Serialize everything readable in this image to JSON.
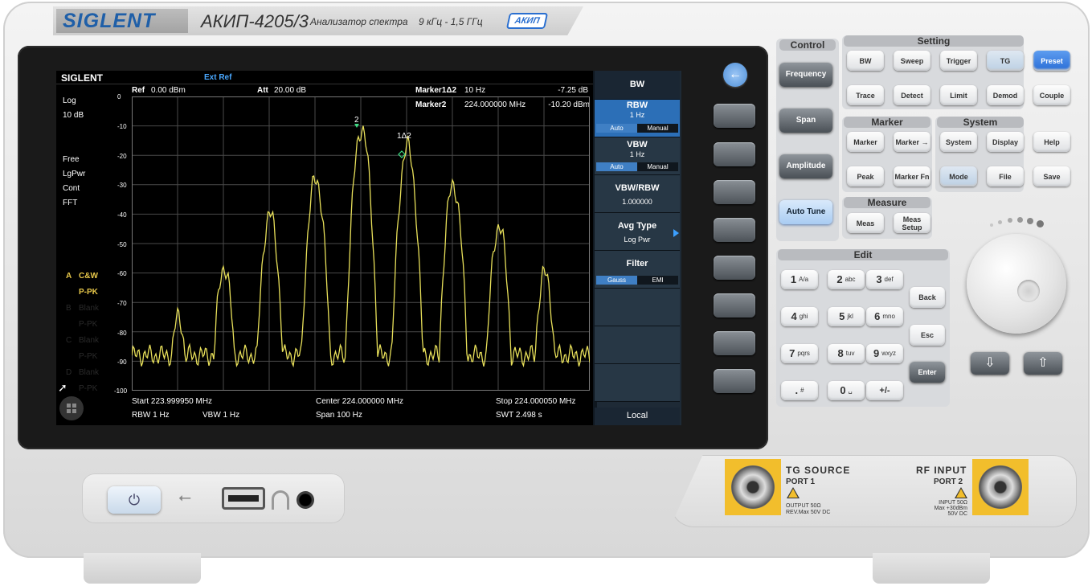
{
  "header": {
    "brand": "SIGLENT",
    "model": "АКИП-4205/3",
    "description": "Анализатор спектра",
    "freq_range": "9 кГц - 1,5 ГГц",
    "akip_logo": "АКИП"
  },
  "screen": {
    "logo": "SIGLENT",
    "ext_ref": "Ext Ref",
    "ref_label": "Ref",
    "ref_value": "0.00 dBm",
    "att_label": "Att",
    "att_value": "20.00 dB",
    "marker1_label": "Marker1Δ2",
    "marker1_freq": "10 Hz",
    "marker1_amp": "-7.25 dB",
    "marker2_label": "Marker2",
    "marker2_freq": "224.000000 MHz",
    "marker2_amp": "-10.20 dBm",
    "scale_type": "Log",
    "scale_div": "10 dB",
    "left_status": [
      "Free",
      "LgPwr",
      "Cont",
      "FFT"
    ],
    "y_ticks": [
      "0",
      "-10",
      "-20",
      "-30",
      "-40",
      "-50",
      "-60",
      "-70",
      "-80",
      "-90",
      "-100"
    ],
    "trace_a": {
      "letter": "A",
      "mode": "C&W",
      "det": "P-PK"
    },
    "trace_b": {
      "letter": "B",
      "mode": "Blank",
      "det": "P-PK"
    },
    "trace_c": {
      "letter": "C",
      "mode": "Blank",
      "det": "P-PK"
    },
    "trace_d": {
      "letter": "D",
      "mode": "Blank",
      "det": "P-PK"
    },
    "marker_tag_2": "2",
    "marker_tag_1d2": "1Δ2",
    "start": "Start  223.999950 MHz",
    "center": "Center  224.000000 MHz",
    "stop": "Stop  224.000050 MHz",
    "rbw": "RBW  1 Hz",
    "vbw": "VBW  1 Hz",
    "span": "Span   100 Hz",
    "swt": "SWT  2.498 s",
    "trace_color": "#e8e05a"
  },
  "menu": {
    "title": "BW",
    "rbw": {
      "label": "RBW",
      "value": "1 Hz",
      "opt1": "Auto",
      "opt2": "Manual"
    },
    "vbw": {
      "label": "VBW",
      "value": "1 Hz",
      "opt1": "Auto",
      "opt2": "Manual"
    },
    "vbw_rbw": {
      "label": "VBW/RBW",
      "value": "1.000000"
    },
    "avg_type": {
      "label": "Avg Type",
      "value": "Log Pwr"
    },
    "filter": {
      "label": "Filter",
      "opt1": "Gauss",
      "opt2": "EMI"
    },
    "local": "Local"
  },
  "panel": {
    "control_title": "Control",
    "setting_title": "Setting",
    "marker_title": "Marker",
    "system_title": "System",
    "measure_title": "Measure",
    "edit_title": "Edit",
    "control": [
      "Frequency",
      "Span",
      "Amplitude",
      "Auto Tune"
    ],
    "setting_row1": [
      "BW",
      "Sweep",
      "Trigger",
      "TG",
      "Preset"
    ],
    "setting_row2": [
      "Trace",
      "Detect",
      "Limit",
      "Demod",
      "Couple"
    ],
    "marker_keys": [
      "Marker",
      "Marker →",
      "Peak",
      "Marker Fn"
    ],
    "system_keys": [
      "System",
      "Display",
      "Help",
      "Mode",
      "File",
      "Save"
    ],
    "measure_keys": [
      "Meas",
      "Meas Setup"
    ],
    "numpad": [
      {
        "d": "1",
        "s": "A/a"
      },
      {
        "d": "2",
        "s": "abc"
      },
      {
        "d": "3",
        "s": "def"
      },
      {
        "d": "4",
        "s": "ghi"
      },
      {
        "d": "5",
        "s": "jkl"
      },
      {
        "d": "6",
        "s": "mno"
      },
      {
        "d": "7",
        "s": "pqrs"
      },
      {
        "d": "8",
        "s": "tuv"
      },
      {
        "d": "9",
        "s": "wxyz"
      },
      {
        "d": ".",
        "s": "#"
      },
      {
        "d": "0",
        "s": "␣"
      },
      {
        "d": "+/-",
        "s": ""
      }
    ],
    "edit_side": [
      "Back",
      "Esc",
      "Enter"
    ],
    "arrow_down": "⇩",
    "arrow_up": "⇧"
  },
  "io": {
    "tg_source": "TG SOURCE",
    "port1": "PORT 1",
    "tg_spec1": "OUTPUT 50Ω",
    "tg_spec2": "REV.Max 50V DC",
    "rf_input": "RF INPUT",
    "port2": "PORT 2",
    "rf_spec1": "INPUT 50Ω",
    "rf_spec2": "Max +30dBm",
    "rf_spec3": "50V DC"
  },
  "icons": {
    "power": "⏻",
    "back": "←",
    "usb": "⭠"
  }
}
